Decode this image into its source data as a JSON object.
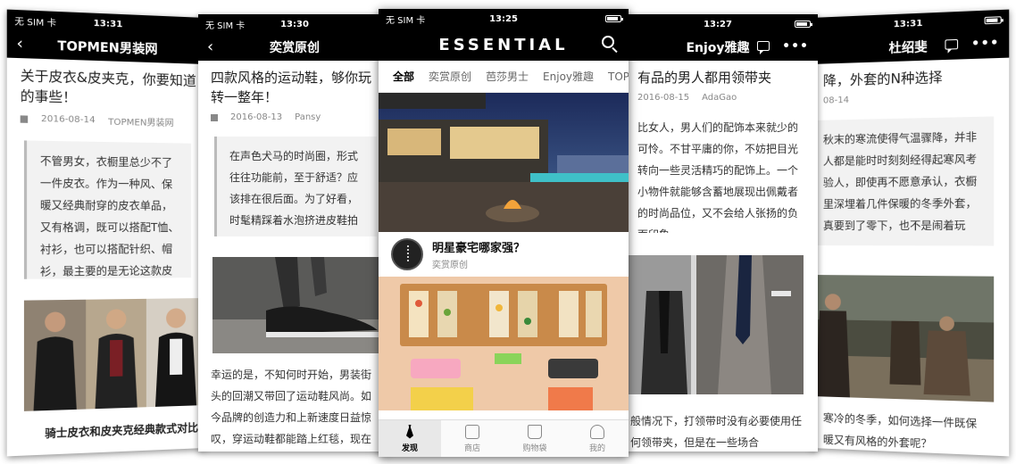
{
  "status": {
    "carrier": "无 SIM 卡",
    "wifi": "ᯤ"
  },
  "screens": {
    "topmen": {
      "time": "13:31",
      "nav_title": "TOPMEN男装网",
      "article_title": "关于皮衣&皮夹克，你要知道的事些！",
      "date": "2016-08-14",
      "source": "TOPMEN男装网",
      "quote": "不管男女，衣橱里总少不了一件皮衣。作为一种风、保暖又经典耐穿的皮衣单品，又有格调，既可以搭配T恤、衬衫，也可以搭配针织、帽衫，最主要的是无论这款皮夹克是不年纪多大了，总能保有迷人的青春气息，十足，百看不腻。",
      "caption": "骑士皮衣和皮夹克经典款式对比"
    },
    "sneaker": {
      "time": "13:30",
      "nav_title": "奕赏原创",
      "article_title": "四款风格的运动鞋，够你玩转一整年！",
      "date": "2016-08-13",
      "source": "Pansy",
      "quote": "在声色犬马的时尚圈，形式往往功能前，至于舒适？应该排在很后面。为了好看，时髦精踩着水泡挤进皮鞋拍照。",
      "body": "幸运的是，不知何时开始，男装街头的回潮又带回了运动鞋风尚。如今品牌的创造力和上新速度日益惊叹，穿运动鞋都能踏上红毯，现在我们来"
    },
    "center": {
      "time": "13:25",
      "brand": "ESSENTIAL",
      "tabs": [
        "全部",
        "奕赏原创",
        "芭莎男士",
        "Enjoy雅趣",
        "TOPMEN"
      ],
      "card_title": "明星豪宅哪家强？",
      "card_sub": "奕赏原创",
      "tabbar": [
        "发现",
        "商店",
        "购物袋",
        "我的"
      ]
    },
    "enjoy": {
      "time": "13:27",
      "nav_title": "Enjoy雅趣",
      "article_title": "有品的男人都用领带夹",
      "date": "2016-08-15",
      "source": "AdaGao",
      "quote": "比女人，男人们的配饰本来就少的可怜。不甘平庸的你，不妨把目光转向一些灵活精巧的配饰上。一个小物件就能够含蓄地展现出佩戴者的时尚品位，又不会给人张扬的负面印象。",
      "body": "般情况下，打领带时没有必要使用任何领带夹，但是在一些场合"
    },
    "du": {
      "time": "13:31",
      "nav_title": "杜绍斐",
      "article_title": "降，外套的N种选择",
      "date": "08-14",
      "quote": "秋末的寒流使得气温骤降，并非人都是能时时刻刻经得起寒风考验人，即使再不愿意承认，衣橱里深埋着几件保暖的冬季外套，真要到了零下，也不是闹着玩",
      "body": "寒冷的冬季，如何选择一件既保暖又有风格的外套呢？"
    }
  }
}
